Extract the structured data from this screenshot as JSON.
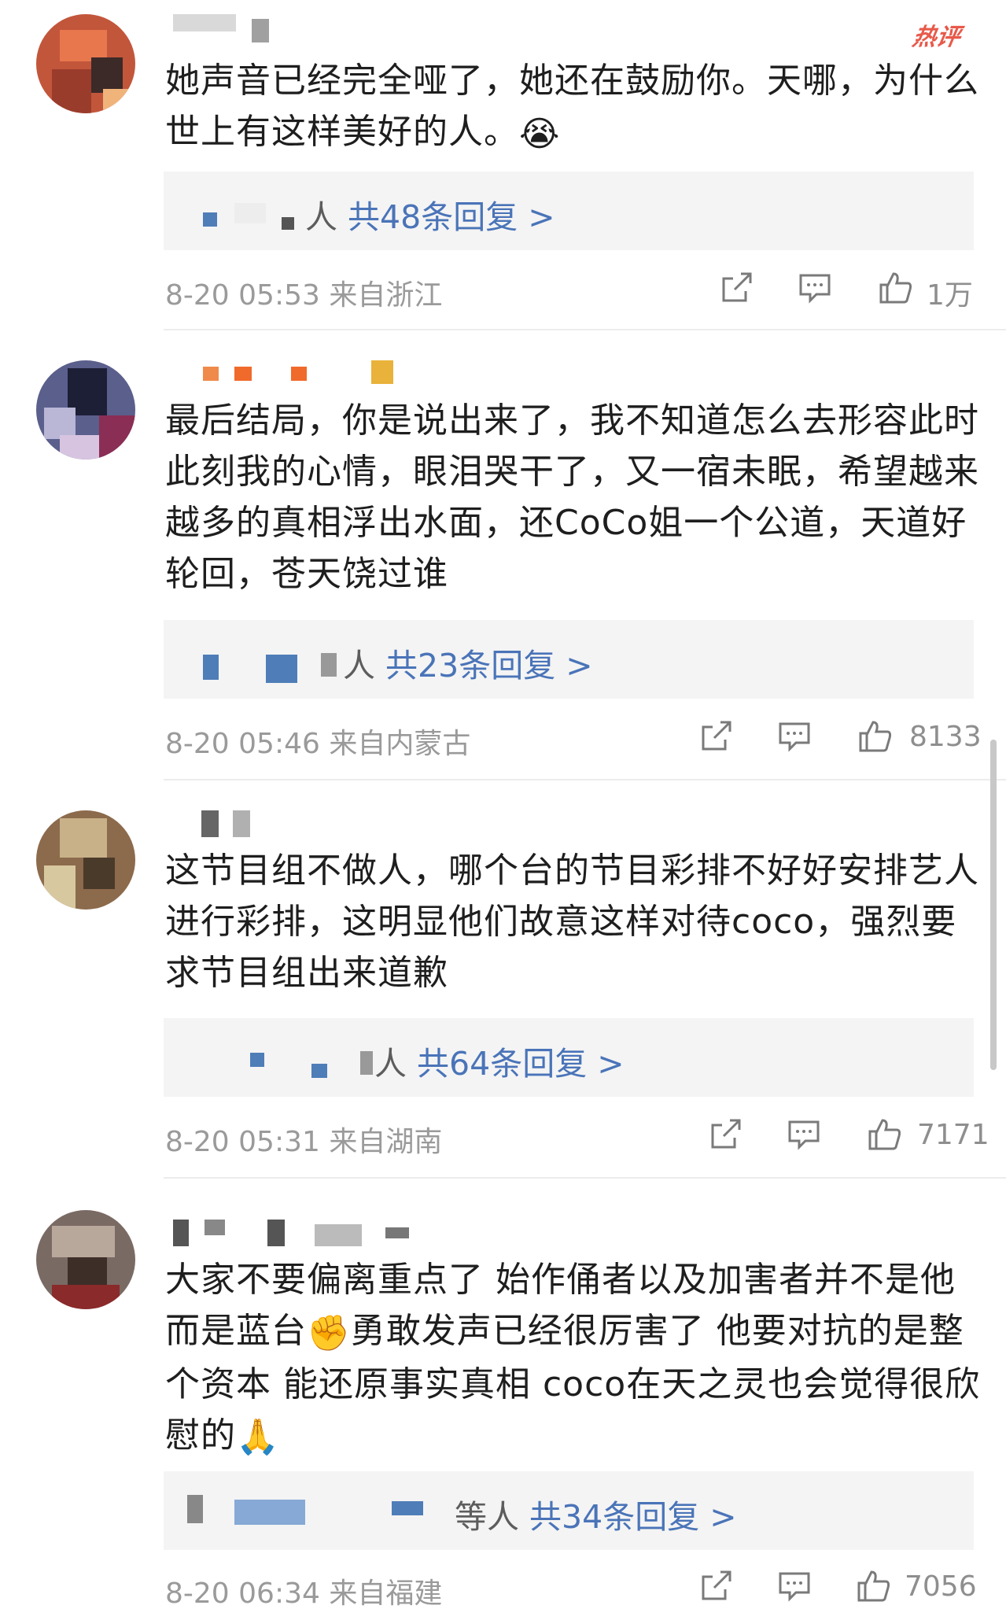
{
  "hot_badge": "热评",
  "icons": {
    "share": "share-icon",
    "comment": "comment-icon",
    "like": "thumbs-up-icon"
  },
  "colors": {
    "link": "#4a74b8",
    "meta": "#9a9a9a",
    "reply_bg": "#f4f4f4",
    "hot": "#e8594a"
  },
  "comments": [
    {
      "text": "她声音已经完全哑了，她还在鼓励你。天哪，为什么世上有这样美好的人。",
      "emoji": "😭",
      "reply_prefix": "人",
      "reply_link": "共48条回复 >",
      "meta": "8-20 05:53 来自浙江",
      "likes": "1万"
    },
    {
      "text": "最后结局，你是说出来了，我不知道怎么去形容此时此刻我的心情，眼泪哭干了，又一宿未眠，希望越来越多的真相浮出水面，还CoCo姐一个公道，天道好轮回，苍天饶过谁",
      "emoji": "",
      "reply_prefix": "人",
      "reply_link": "共23条回复 >",
      "meta": "8-20 05:46 来自内蒙古",
      "likes": "8133"
    },
    {
      "text": "这节目组不做人，哪个台的节目彩排不好好安排艺人进行彩排，这明显他们故意这样对待coco，强烈要求节目组出来道歉",
      "emoji": "",
      "reply_prefix": "人",
      "reply_link": "共64条回复 >",
      "meta": "8-20 05:31 来自湖南",
      "likes": "7171"
    },
    {
      "text_a": "大家不要偏离重点了 始作俑者以及加害者并不是他而是蓝台",
      "emoji_a": "✊",
      "text_b": "勇敢发声已经很厉害了 他要对抗的是整个资本 能还原事实真相 coco在天之灵也会觉得很欣慰的",
      "emoji_b": "🙏",
      "reply_prefix": "等人",
      "reply_link": "共34条回复 >",
      "meta": "8-20 06:34 来自福建",
      "likes": "7056"
    }
  ]
}
